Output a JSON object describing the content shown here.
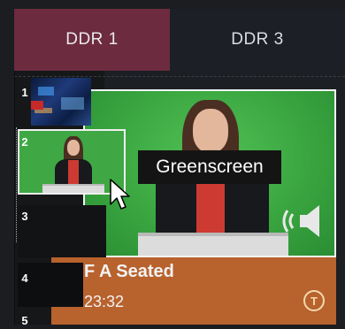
{
  "tabs": [
    {
      "label": "DDR 1",
      "active": true
    },
    {
      "label": "DDR 3",
      "active": false
    }
  ],
  "playlist": {
    "row_numbers": [
      "1",
      "2",
      "3",
      "4",
      "5"
    ],
    "tooltip": "Greenscreen",
    "selected_clip": {
      "title": "F A Seated",
      "duration": "23:32",
      "badge": "T"
    }
  },
  "colors": {
    "active_tab": "#6d2b3f",
    "inactive_tab": "#1c2026",
    "greenscreen": "#3fa845",
    "clip_bar": "#b8622d"
  },
  "icons": {
    "cursor": "mouse-pointer-icon",
    "speaker": "speaker-audio-icon",
    "badge": "title-badge-icon"
  }
}
